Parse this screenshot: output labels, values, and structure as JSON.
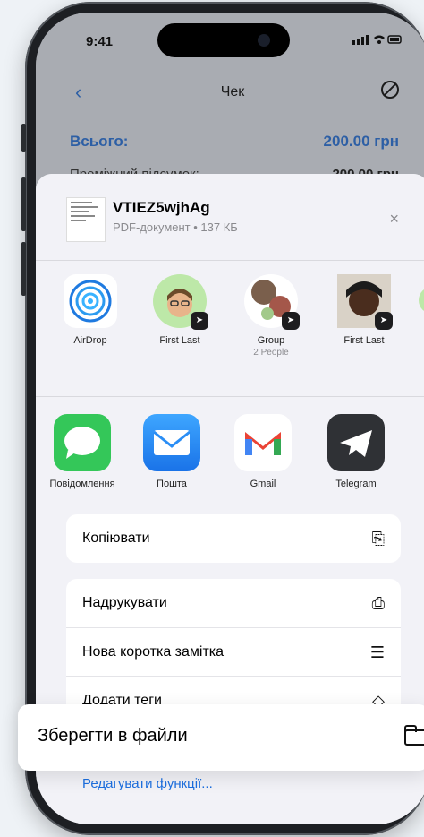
{
  "status_bar": {
    "time": "9:41",
    "icons": "▐▐ ≡ ▭"
  },
  "nav": {
    "title": "Чек"
  },
  "receipt": {
    "total_label": "Всього:",
    "total_value": "200.00 грн",
    "subtotal_label": "Проміжний підсумок:",
    "subtotal_value": "200.00 грн"
  },
  "share": {
    "doc_name": "VTIEZ5wjhAg",
    "doc_meta": "PDF-документ • 137 КБ",
    "close_icon": "×",
    "people": [
      {
        "label": "AirDrop",
        "sub": ""
      },
      {
        "label": "First Last",
        "sub": ""
      },
      {
        "label": "Group",
        "sub": "2 People"
      },
      {
        "label": "First Last",
        "sub": ""
      }
    ],
    "apps": [
      {
        "label": "Повідомлення",
        "color": "#34c759"
      },
      {
        "label": "Пошта",
        "color": "#2b8ef5"
      },
      {
        "label": "Gmail",
        "color": "#ffffff"
      },
      {
        "label": "Telegram",
        "color": "#2f3135"
      }
    ],
    "actions_group1": [
      {
        "label": "Копіювати",
        "icon": "copy-icon"
      }
    ],
    "actions_group2": [
      {
        "label": "Надрукувати",
        "icon": "printer-icon"
      },
      {
        "label": "Нова коротка замітка",
        "icon": "quick-note-icon"
      },
      {
        "label": "Додати теги",
        "icon": "tag-icon"
      }
    ],
    "edit_actions": "Редагувати функції..."
  },
  "save_to_files": {
    "label": "Зберегти в файли",
    "icon": "folder-icon"
  }
}
